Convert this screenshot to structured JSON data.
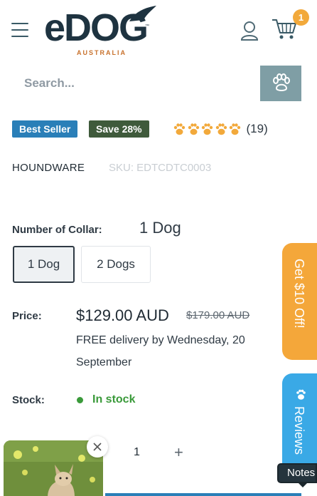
{
  "header": {
    "logo_text": "eDOG",
    "logo_tagline": "AUSTRALIA",
    "logo_tm": "™",
    "cart_count": "1"
  },
  "search": {
    "placeholder": "Search..."
  },
  "badges": {
    "best_seller": "Best Seller",
    "save": "Save 28%"
  },
  "rating": {
    "paws": 5,
    "count_label": "(19)"
  },
  "product": {
    "vendor": "HOUNDWARE",
    "sku": "SKU: EDTCDTC0003"
  },
  "variant": {
    "label": "Number of Collar:",
    "selected_value": "1 Dog",
    "options": [
      "1 Dog",
      "2 Dogs"
    ]
  },
  "price": {
    "label": "Price:",
    "current": "$129.00 AUD",
    "compare_at": "$179.00 AUD",
    "delivery": "FREE delivery by Wednesday, 20 September"
  },
  "stock": {
    "label": "Stock:",
    "status": "In stock"
  },
  "quantity": {
    "value": "1",
    "plus": "+"
  },
  "side_tabs": {
    "offer": "Get $10 Off!",
    "reviews": "Reviews"
  },
  "notes": {
    "label": "Notes"
  },
  "colors": {
    "brand_dark": "#1e3340",
    "brand_orange": "#c8712c",
    "best_seller": "#2a7fb8",
    "save_badge": "#3f5a3b",
    "paw_rating": "#f2a93b",
    "in_stock": "#3a9a3a",
    "offer_tab": "#f4a73a",
    "reviews_tab": "#3aa9e6"
  }
}
